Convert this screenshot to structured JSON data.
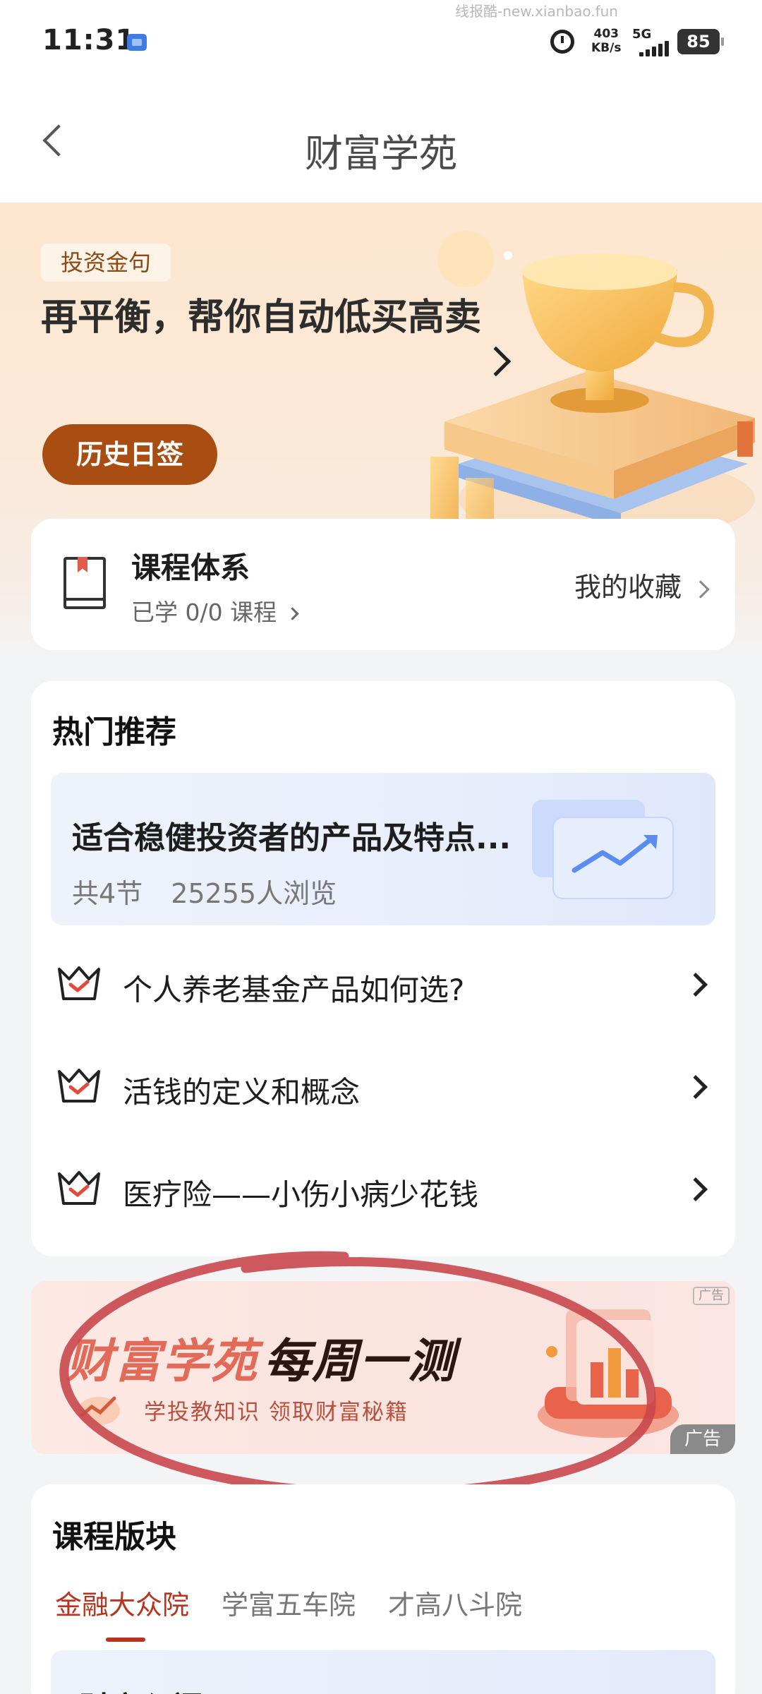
{
  "status_bar": {
    "time": "11:31",
    "watermark": "线报酷-new.xianbao.fun",
    "speed_value": "403",
    "speed_unit": "KB/s",
    "network": "5G",
    "battery": "85"
  },
  "nav": {
    "title": "财富学苑"
  },
  "hero": {
    "tag": "投资金句",
    "quote": "再平衡，帮你自动低买高卖",
    "button": "历史日签"
  },
  "course_system": {
    "title": "课程体系",
    "progress": "已学 0/0 课程",
    "favorites": "我的收藏"
  },
  "hot": {
    "title": "热门推荐",
    "featured": {
      "title": "适合稳健投资者的产品及特点...",
      "sections": "共4节",
      "views": "25255人浏览"
    },
    "items": [
      {
        "label": "个人养老基金产品如何选?"
      },
      {
        "label": "活钱的定义和概念"
      },
      {
        "label": "医疗险——小伤小病少花钱"
      }
    ]
  },
  "ad": {
    "title_part1": "财富学苑",
    "title_part2": "每周一测",
    "subtitle": "学投教知识 领取财富秘籍",
    "tag_top": "广告",
    "tag_bottom": "广告"
  },
  "modules": {
    "title": "课程版块",
    "tabs": [
      "金融大众院",
      "学富五车院",
      "才高八斗院"
    ],
    "active_tab": "金融大众院",
    "first_card_title": "财商入门"
  },
  "colors": {
    "accent": "#b8341f",
    "hero_button": "#a84e12",
    "annotation": "#c9474d"
  }
}
